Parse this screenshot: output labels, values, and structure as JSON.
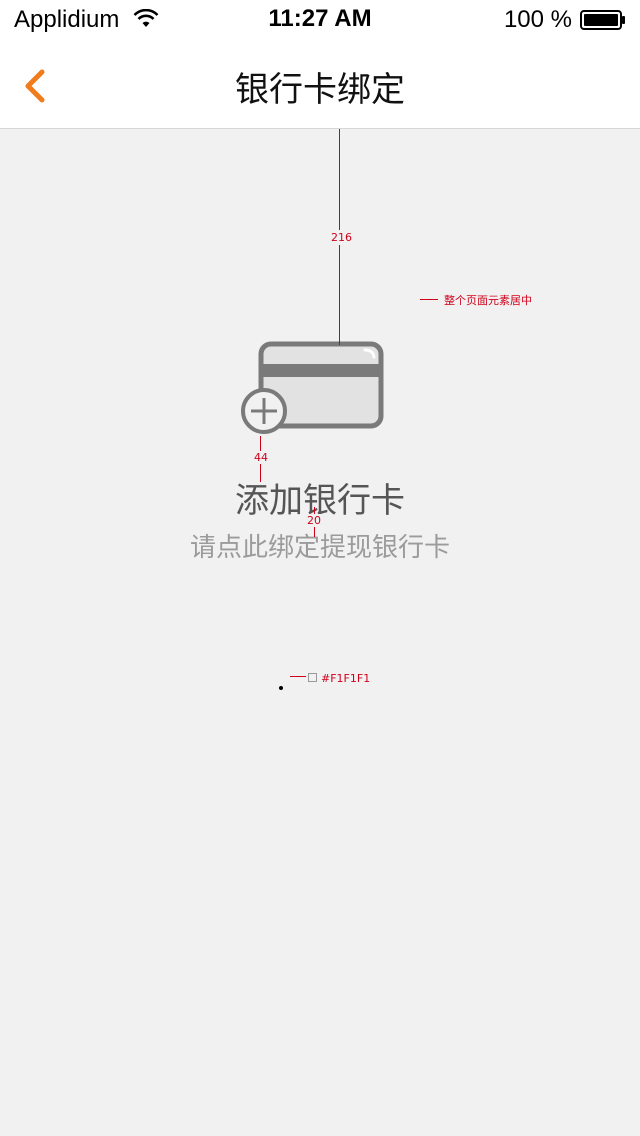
{
  "status_bar": {
    "carrier": "Applidium",
    "time": "11:27 AM",
    "battery": "100 %"
  },
  "nav": {
    "title": "银行卡绑定",
    "back_icon": "chevron-left-icon"
  },
  "main": {
    "icon": "bank-card-add-icon",
    "title": "添加银行卡",
    "subtitle": "请点此绑定提现银行卡"
  },
  "annotations": {
    "top_spacing": "216",
    "center_note": "整个页面元素居中",
    "icon_text_spacing": "44",
    "text_spacing": "20",
    "bg_color_label": "#F1F1F1"
  },
  "colors": {
    "accent": "#F07C1C",
    "background": "#F1F1F1",
    "annotation": "#D0021B"
  }
}
